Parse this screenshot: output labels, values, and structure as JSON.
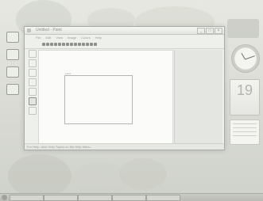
{
  "window": {
    "title": "Untitled - Paint",
    "buttons": [
      "_",
      "□",
      "×"
    ],
    "menu": [
      "File",
      "Edit",
      "View",
      "Image",
      "Colors",
      "Help"
    ],
    "status_left": "For Help, click Help Topics on the Help Menu.",
    "status_right": "",
    "canvas_label": "Label"
  },
  "gadgets": {
    "calendar": {
      "month": "",
      "day": "19",
      "weekday": ""
    }
  },
  "taskbar": {
    "tasks": [
      "",
      "",
      "",
      "",
      ""
    ],
    "clock": ""
  }
}
